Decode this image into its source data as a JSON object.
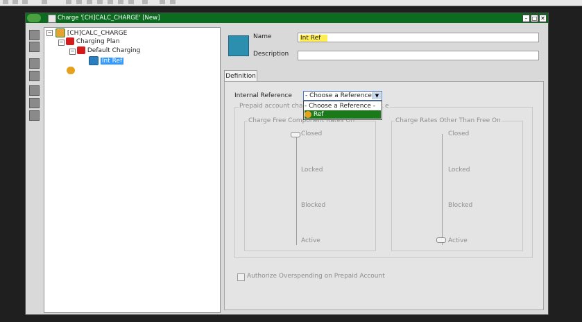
{
  "window": {
    "title": "Charge '[CH]CALC_CHARGE' [New]",
    "controls": [
      "–",
      "□",
      "✕"
    ]
  },
  "tree": [
    {
      "label": "[CH]CALC_CHARGE",
      "icon": "charge-icon"
    },
    {
      "label": "Charging Plan",
      "icon": "charging-plan-icon"
    },
    {
      "label": "Default Charging",
      "icon": "charging-icon"
    },
    {
      "label": "Int Ref",
      "icon": "reference-icon",
      "selected": true
    }
  ],
  "form": {
    "name_label": "Name",
    "name_value": "Int Ref",
    "description_label": "Description",
    "description_value": ""
  },
  "tabs": [
    {
      "label": "Definition",
      "active": true
    }
  ],
  "definition": {
    "internal_reference_label": "Internal Reference",
    "dropdown_value": "- Choose a Reference -",
    "options": [
      {
        "label": "- Choose a Reference -",
        "highlighted": false
      },
      {
        "label": "Ref",
        "highlighted": true
      }
    ],
    "prepaid_group_label_left": "Prepaid account charg",
    "prepaid_group_label_right": "e",
    "free_group": {
      "label": "Charge Free Component Rates On",
      "levels": [
        "Closed",
        "Locked",
        "Blocked",
        "Active"
      ],
      "selected": "Closed"
    },
    "other_group": {
      "label": "Charge Rates Other Than Free On",
      "levels": [
        "Closed",
        "Locked",
        "Blocked",
        "Active"
      ],
      "selected": "Active"
    },
    "overspend_label": "Authorize Overspending on Prepaid Account",
    "overspend_checked": false
  },
  "colors": {
    "titlebar": "#0b6b1f",
    "selection": "#3399ff",
    "dropdown_highlight": "#1a7a1a",
    "name_highlight": "#ffee55"
  }
}
